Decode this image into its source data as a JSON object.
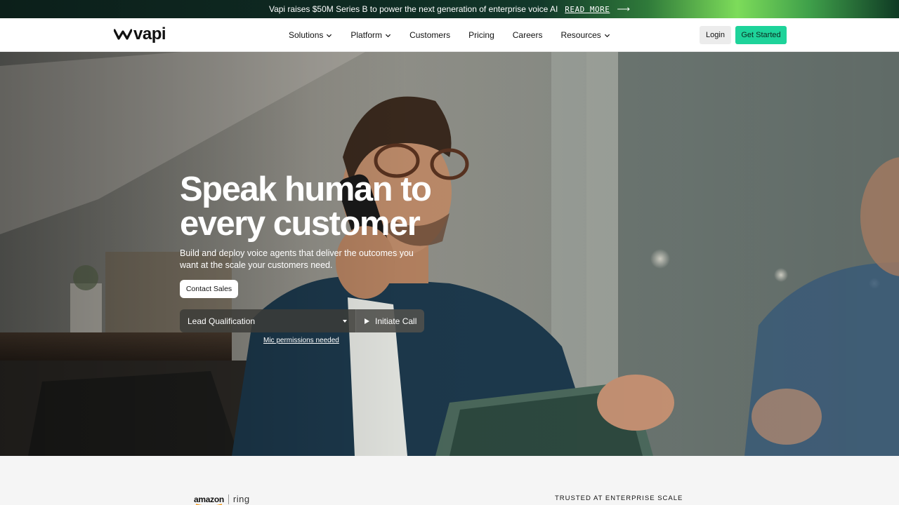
{
  "banner": {
    "text": "Vapi raises $50M Series B to power the next generation of enterprise voice AI",
    "link_label": "READ MORE",
    "arrow": "⟶"
  },
  "nav": {
    "logo_text": "vapi",
    "links": [
      {
        "label": "Solutions",
        "has_dropdown": true
      },
      {
        "label": "Platform",
        "has_dropdown": true
      },
      {
        "label": "Customers",
        "has_dropdown": false
      },
      {
        "label": "Pricing",
        "has_dropdown": false
      },
      {
        "label": "Careers",
        "has_dropdown": false
      },
      {
        "label": "Resources",
        "has_dropdown": true
      }
    ],
    "login_label": "Login",
    "get_started_label": "Get Started"
  },
  "hero": {
    "title": "Speak human to every customer",
    "subtitle": "Build and deploy voice agents that deliver the outcomes you want at the scale your customers need.",
    "contact_label": "Contact Sales",
    "select_value": "Lead Qualification",
    "initiate_label": "Initiate Call",
    "mic_note": "Mic permissions needed"
  },
  "trust": {
    "brand_1": "amazon",
    "brand_2": "ring",
    "label": "TRUSTED AT ENTERPRISE SCALE"
  },
  "colors": {
    "accent": "#1ed39a",
    "banner_dark": "#0c1f1a",
    "banner_glow": "#7ddc5a"
  }
}
